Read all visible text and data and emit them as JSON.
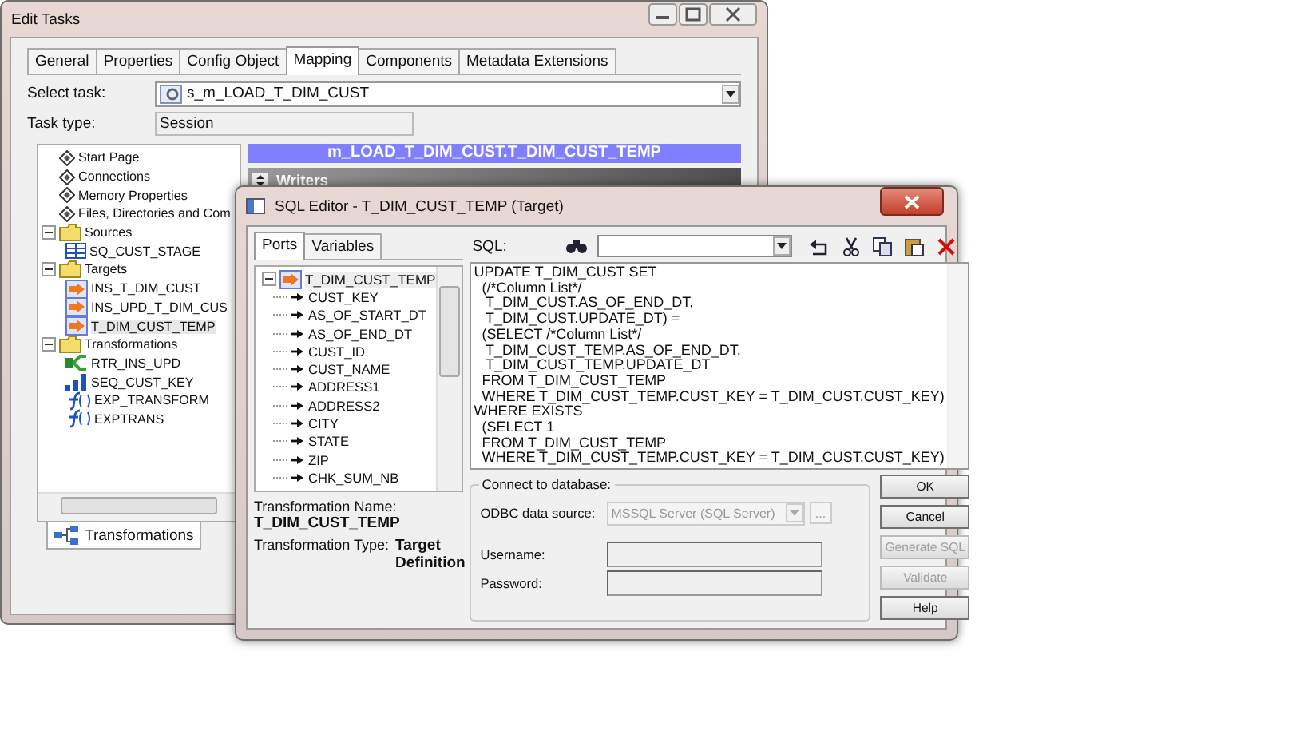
{
  "edit_tasks": {
    "title": "Edit Tasks",
    "tabs": [
      {
        "label": "General",
        "selected": false
      },
      {
        "label": "Properties",
        "selected": false
      },
      {
        "label": "Config Object",
        "selected": false
      },
      {
        "label": "Mapping",
        "selected": true
      },
      {
        "label": "Components",
        "selected": false
      },
      {
        "label": "Metadata Extensions",
        "selected": false
      }
    ],
    "select_task": {
      "label": "Select task:",
      "value": "s_m_LOAD_T_DIM_CUST"
    },
    "task_type": {
      "label": "Task type:",
      "value": "Session"
    },
    "tree": [
      {
        "label": "Start Page",
        "kind": "page",
        "selected": false
      },
      {
        "label": "Connections",
        "kind": "page",
        "selected": false
      },
      {
        "label": "Memory Properties",
        "kind": "page",
        "selected": false
      },
      {
        "label": "Files, Directories and Com",
        "kind": "page",
        "selected": false
      },
      {
        "label": "Sources",
        "kind": "folder",
        "expanded": true,
        "selected": false,
        "children": [
          {
            "label": "SQ_CUST_STAGE",
            "kind": "source",
            "selected": false
          }
        ]
      },
      {
        "label": "Targets",
        "kind": "folder",
        "expanded": true,
        "selected": false,
        "children": [
          {
            "label": "INS_T_DIM_CUST",
            "kind": "target",
            "selected": false
          },
          {
            "label": "INS_UPD_T_DIM_CUS",
            "kind": "target",
            "selected": false
          },
          {
            "label": "T_DIM_CUST_TEMP",
            "kind": "target",
            "selected": true
          }
        ]
      },
      {
        "label": "Transformations",
        "kind": "folder",
        "expanded": true,
        "selected": false,
        "children": [
          {
            "label": "RTR_INS_UPD",
            "kind": "router",
            "selected": false
          },
          {
            "label": "SEQ_CUST_KEY",
            "kind": "sequence",
            "selected": false
          },
          {
            "label": "EXP_TRANSFORM",
            "kind": "expression",
            "selected": false
          },
          {
            "label": "EXPTRANS",
            "kind": "expression",
            "selected": false
          }
        ]
      }
    ],
    "bottom_tab": "Transformations",
    "banner": "m_LOAD_T_DIM_CUST.T_DIM_CUST_TEMP",
    "section": "Writers"
  },
  "sql_editor": {
    "title": "SQL Editor - T_DIM_CUST_TEMP (Target)",
    "tabs": [
      {
        "label": "Ports",
        "selected": true
      },
      {
        "label": "Variables",
        "selected": false
      }
    ],
    "ports_tree": {
      "label": "T_DIM_CUST_TEMP",
      "expanded": true,
      "children": [
        "CUST_KEY",
        "AS_OF_START_DT",
        "AS_OF_END_DT",
        "CUST_ID",
        "CUST_NAME",
        "ADDRESS1",
        "ADDRESS2",
        "CITY",
        "STATE",
        "ZIP",
        "CHK_SUM_NB"
      ]
    },
    "name_label": "Transformation Name:",
    "name": "T_DIM_CUST_TEMP",
    "type_label": "Transformation Type:",
    "type": "Target Definition",
    "sql_label": "SQL:",
    "sql_lines": [
      "UPDATE T_DIM_CUST SET",
      "  (/*Column List*/",
      "   T_DIM_CUST.AS_OF_END_DT,",
      "   T_DIM_CUST.UPDATE_DT) =",
      "  (SELECT /*Column List*/",
      "   T_DIM_CUST_TEMP.AS_OF_END_DT,",
      "   T_DIM_CUST_TEMP.UPDATE_DT",
      "  FROM T_DIM_CUST_TEMP",
      "  WHERE T_DIM_CUST_TEMP.CUST_KEY = T_DIM_CUST.CUST_KEY)",
      "WHERE EXISTS",
      "  (SELECT 1",
      "  FROM T_DIM_CUST_TEMP",
      "  WHERE T_DIM_CUST_TEMP.CUST_KEY = T_DIM_CUST.CUST_KEY)"
    ],
    "connect": {
      "legend": "Connect to database:",
      "odbc_label": "ODBC data source:",
      "odbc_value": "MSSQL Server (SQL Server)",
      "browse": "...",
      "username_label": "Username:",
      "password_label": "Password:"
    },
    "buttons": [
      {
        "label": "OK",
        "disabled": false
      },
      {
        "label": "Cancel",
        "disabled": false
      },
      {
        "label": "Generate SQL",
        "disabled": true
      },
      {
        "label": "Validate",
        "disabled": true
      },
      {
        "label": "Help",
        "disabled": false
      }
    ]
  }
}
